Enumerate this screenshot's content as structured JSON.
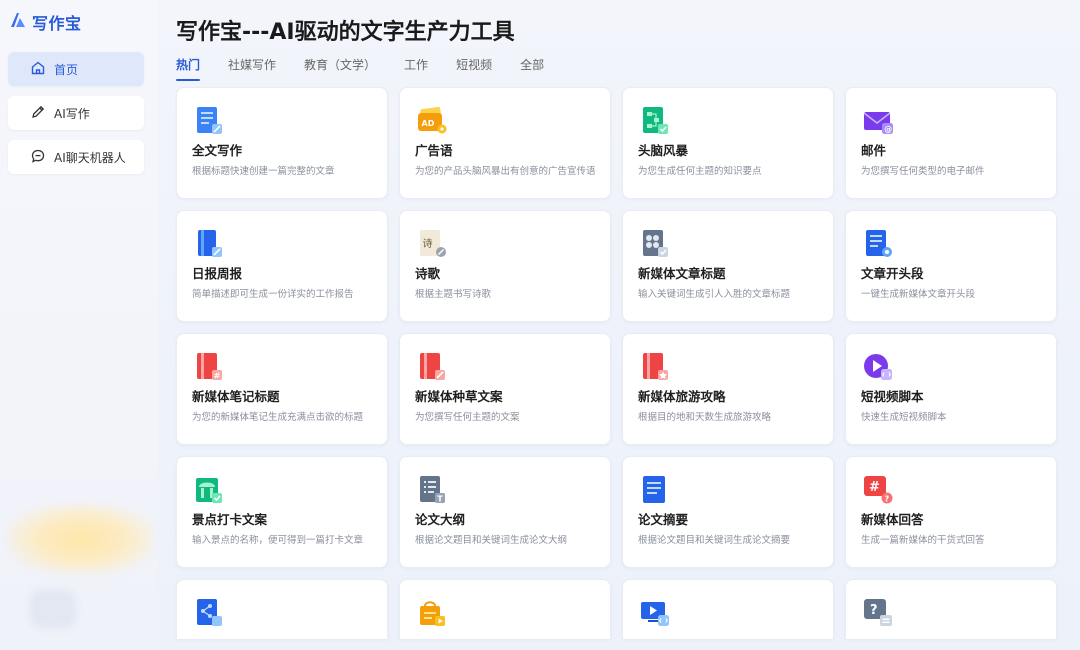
{
  "app": {
    "logo_text": "写作宝"
  },
  "sidebar": {
    "items": [
      {
        "label": "首页",
        "icon": "home-icon",
        "active": true
      },
      {
        "label": "AI写作",
        "icon": "pen-icon",
        "active": false
      },
      {
        "label": "AI聊天机器人",
        "icon": "chat-icon",
        "active": false
      }
    ]
  },
  "header": {
    "title": "写作宝---AI驱动的文字生产力工具"
  },
  "tabs": [
    {
      "label": "热门",
      "active": true
    },
    {
      "label": "社媒写作",
      "active": false
    },
    {
      "label": "教育（文学）",
      "active": false
    },
    {
      "label": "工作",
      "active": false
    },
    {
      "label": "短视频",
      "active": false
    },
    {
      "label": "全部",
      "active": false
    }
  ],
  "cards": [
    {
      "title": "全文写作",
      "desc": "根据标题快速创建一篇完整的文章",
      "icon": "document-pen-icon"
    },
    {
      "title": "广告语",
      "desc": "为您的产品头脑风暴出有创意的广告宣传语",
      "icon": "ad-tag-icon"
    },
    {
      "title": "头脑风暴",
      "desc": "为您生成任何主题的知识要点",
      "icon": "mindmap-icon"
    },
    {
      "title": "邮件",
      "desc": "为您撰写任何类型的电子邮件",
      "icon": "email-icon"
    },
    {
      "title": "日报周报",
      "desc": "简单描述即可生成一份详实的工作报告",
      "icon": "report-book-icon"
    },
    {
      "title": "诗歌",
      "desc": "根据主题书写诗歌",
      "icon": "poem-icon"
    },
    {
      "title": "新媒体文章标题",
      "desc": "输入关键词生成引人入胜的文章标题",
      "icon": "title-grid-icon"
    },
    {
      "title": "文章开头段",
      "desc": "一键生成新媒体文章开头段",
      "icon": "doc-gear-icon"
    },
    {
      "title": "新媒体笔记标题",
      "desc": "为您的新媒体笔记生成充满点击欲的标题",
      "icon": "red-note-icon"
    },
    {
      "title": "新媒体种草文案",
      "desc": "为您撰写任何主题的文案",
      "icon": "red-note-pen-icon"
    },
    {
      "title": "新媒体旅游攻略",
      "desc": "根据目的地和天数生成旅游攻略",
      "icon": "red-note-star-icon"
    },
    {
      "title": "短视频脚本",
      "desc": "快速生成短视频脚本",
      "icon": "video-play-icon"
    },
    {
      "title": "景点打卡文案",
      "desc": "输入景点的名称，便可得到一篇打卡文章",
      "icon": "landmark-icon"
    },
    {
      "title": "论文大纲",
      "desc": "根据论文题目和关键词生成论文大纲",
      "icon": "outline-doc-icon"
    },
    {
      "title": "论文摘要",
      "desc": "根据论文题目和关键词生成论文摘要",
      "icon": "abstract-doc-icon"
    },
    {
      "title": "新媒体回答",
      "desc": "生成一篇新媒体的干货式回答",
      "icon": "hashtag-question-icon"
    }
  ],
  "partial_cards": [
    {
      "icon": "share-doc-icon"
    },
    {
      "icon": "shopping-bag-icon"
    },
    {
      "icon": "video-code-icon"
    },
    {
      "icon": "question-board-icon"
    }
  ],
  "colors": {
    "accent": "#2a5bd7",
    "active_bg": "#dfe8fb"
  }
}
